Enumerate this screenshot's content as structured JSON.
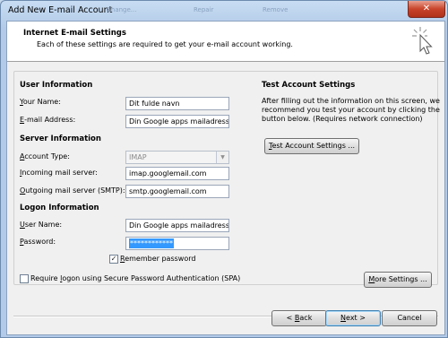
{
  "window": {
    "title": "Add New E-mail Account",
    "close_symbol": "✕",
    "background_menu": [
      "Change...",
      "Repair",
      "Remove"
    ]
  },
  "header": {
    "title": "Internet E-mail Settings",
    "subtitle": "Each of these settings are required to get your e-mail account working.",
    "icon": "cursor-click-icon"
  },
  "user_info": {
    "heading": "User Information",
    "name_label_accel": "Y",
    "name_label_rest": "our Name:",
    "name_value": "Dit fulde navn",
    "email_label_accel": "E",
    "email_label_rest": "-mail Address:",
    "email_value": "Din Google apps mailadresse"
  },
  "server_info": {
    "heading": "Server Information",
    "account_type_label_accel": "A",
    "account_type_label_rest": "ccount Type:",
    "account_type_value": "IMAP",
    "incoming_label_accel": "I",
    "incoming_label_rest": "ncoming mail server:",
    "incoming_value": "imap.googlemail.com",
    "outgoing_label_accel": "O",
    "outgoing_label_rest": "utgoing mail server (SMTP):",
    "outgoing_value": "smtp.googlemail.com"
  },
  "logon_info": {
    "heading": "Logon Information",
    "username_label_accel": "U",
    "username_label_rest": "ser Name:",
    "username_value": "Din Google apps mailadresse",
    "password_label_accel": "P",
    "password_label_rest": "assword:",
    "password_value": "************",
    "remember_accel": "R",
    "remember_rest": "emember password",
    "remember_checked": true,
    "spa_label_pre": "Require ",
    "spa_label_accel": "l",
    "spa_label_rest": "ogon using Secure Password Authentication (SPA)",
    "spa_checked": false
  },
  "test_settings": {
    "heading": "Test Account Settings",
    "description": "After filling out the information on this screen, we recommend you test your account by clicking the button below. (Requires network connection)",
    "button_accel": "T",
    "button_rest": "est Account Settings ..."
  },
  "footer": {
    "more_settings_accel": "M",
    "more_settings_rest": "ore Settings ...",
    "back_pre": "< ",
    "back_accel": "B",
    "back_rest": "ack",
    "next_accel": "N",
    "next_rest": "ext >",
    "cancel_label": "Cancel"
  },
  "checkmark_symbol": "✓",
  "combo_arrow_symbol": "▼"
}
